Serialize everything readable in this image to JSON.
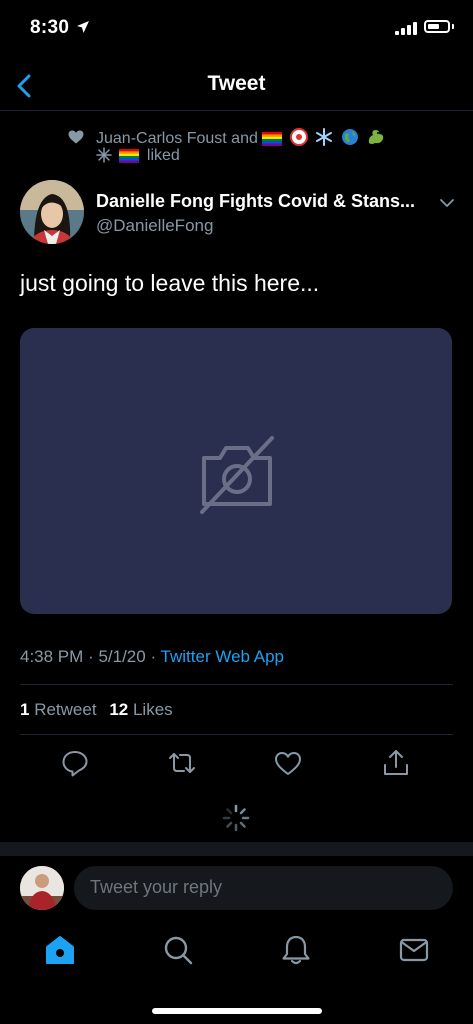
{
  "status_bar": {
    "time": "8:30"
  },
  "header": {
    "title": "Tweet",
    "back_icon": "chevron-left-icon"
  },
  "social_context": {
    "line1_text": "Juan-Carlos Foust and",
    "line2_text": "liked",
    "icon": "heart-icon"
  },
  "tweet": {
    "display_name": "Danielle Fong Fights Covid & Stans...",
    "handle": "@DanielleFong",
    "text": "just going to leave this here...",
    "time": "4:38 PM",
    "date": "5/1/20",
    "source_app": "Twitter Web App",
    "separator": "·",
    "retweet_count": "1",
    "retweet_label": "Retweet",
    "like_count": "12",
    "like_label": "Likes",
    "media_placeholder_icon": "camera-off-icon"
  },
  "actions": [
    "reply-icon",
    "retweet-icon",
    "like-icon",
    "share-icon"
  ],
  "reply": {
    "placeholder": "Tweet your reply"
  },
  "tab_bar": {
    "items": [
      "home-icon",
      "search-icon",
      "notifications-icon",
      "messages-icon"
    ],
    "active": "home-icon"
  },
  "colors": {
    "background": "#000000",
    "accent": "#1da1f2",
    "muted_text": "#8899a6",
    "divider": "#1e2430",
    "media_bg": "#2b2f4f",
    "input_bg": "#15181c"
  }
}
